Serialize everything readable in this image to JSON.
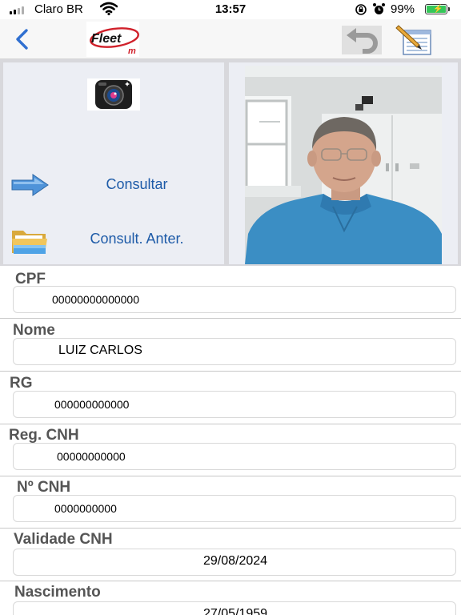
{
  "status_bar": {
    "carrier": "Claro BR",
    "time": "13:57",
    "battery_percent": "99%",
    "battery_level": 0.99,
    "signal_bars": 2
  },
  "nav": {
    "logo_text": "Fleet",
    "logo_sub": "m"
  },
  "actions": {
    "consultar": "Consultar",
    "consult_anter": "Consult. Anter."
  },
  "form": {
    "cpf_label": "CPF",
    "cpf_value": "00000000000000",
    "nome_label": "Nome",
    "nome_value": "LUIZ CARLOS",
    "rg_label": "RG",
    "rg_value": "000000000000",
    "reg_cnh_label": "Reg. CNH",
    "reg_cnh_value": "00000000000",
    "n_cnh_label": "Nº CNH",
    "n_cnh_value": "0000000000",
    "validade_label": "Validade CNH",
    "validade_value": "29/08/2024",
    "nascimento_label": "Nascimento",
    "nascimento_value": "27/05/1959"
  },
  "colors": {
    "link_blue": "#1e5ba8",
    "nav_blue": "#2f6fd0",
    "battery_green": "#35c759",
    "logo_red": "#d0202a"
  }
}
